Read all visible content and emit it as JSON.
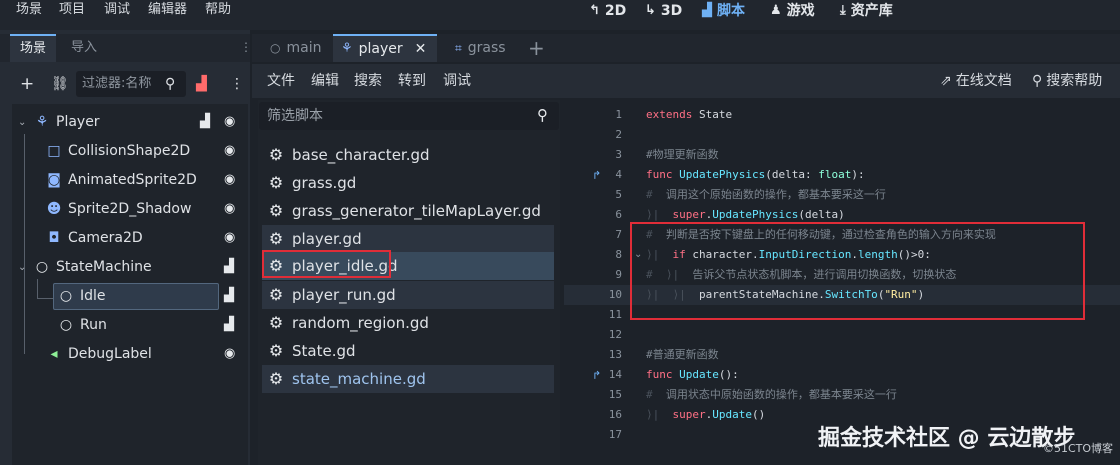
{
  "menubar": {
    "items": [
      "场景",
      "项目",
      "调试",
      "编辑器",
      "帮助"
    ]
  },
  "workspaces": [
    {
      "label": "2D",
      "icon": "2d-icon"
    },
    {
      "label": "3D",
      "icon": "3d-icon"
    },
    {
      "label": "脚本",
      "icon": "script-icon",
      "active": true
    },
    {
      "label": "游戏",
      "icon": "game-icon"
    },
    {
      "label": "资产库",
      "icon": "asset-lib-icon"
    }
  ],
  "dock": {
    "tabs": [
      "场景",
      "导入"
    ],
    "filter_placeholder": "过滤器:名称"
  },
  "tree": {
    "nodes": [
      {
        "label": "Player",
        "icon": "player-node-icon"
      },
      {
        "label": "CollisionShape2D",
        "icon": "collision-shape-icon"
      },
      {
        "label": "AnimatedSprite2D",
        "icon": "animated-sprite-icon"
      },
      {
        "label": "Sprite2D_Shadow",
        "icon": "sprite-icon"
      },
      {
        "label": "Camera2D",
        "icon": "camera-icon"
      },
      {
        "label": "StateMachine",
        "icon": "node-icon"
      },
      {
        "label": "Idle",
        "icon": "node-icon"
      },
      {
        "label": "Run",
        "icon": "node-icon"
      },
      {
        "label": "DebugLabel",
        "icon": "label-icon"
      }
    ]
  },
  "editor_tabs": [
    {
      "label": "main"
    },
    {
      "label": "player",
      "active": true
    },
    {
      "label": "grass"
    }
  ],
  "script_menu": {
    "items": [
      "文件",
      "编辑",
      "搜索",
      "转到",
      "调试"
    ],
    "online_docs": "在线文档",
    "search_help": "搜索帮助"
  },
  "script_filter_placeholder": "筛选脚本",
  "scripts": [
    "base_character.gd",
    "grass.gd",
    "grass_generator_tileMapLayer.gd",
    "player.gd",
    "player_idle.gd",
    "player_run.gd",
    "random_region.gd",
    "State.gd",
    "state_machine.gd"
  ],
  "code": {
    "line_numbers": [
      "1",
      "2",
      "3",
      "4",
      "5",
      "6",
      "7",
      "8",
      "9",
      "10",
      "11",
      "12",
      "13",
      "14",
      "15",
      "16",
      "17"
    ],
    "l1a": "extends",
    "l1b": " State",
    "l3": "#物理更新函数",
    "l4a": "func",
    "l4b": " UpdatePhysics",
    "l4c": "(delta: ",
    "l4d": "float",
    "l4e": "):",
    "l5": "调用这个原始函数的操作，都基本要采这一行",
    "l6a": "super",
    "l6b": ".",
    "l6c": "UpdatePhysics",
    "l6d": "(delta)",
    "l7": "判断是否按下键盘上的任何移动键，通过检查角色的输入方向来实现",
    "l8a": "if",
    "l8b": " character.",
    "l8c": "InputDirection",
    "l8d": ".",
    "l8e": "length",
    "l8f": "()>0:",
    "l9": "告诉父节点状态机脚本，进行调用切换函数，切换状态",
    "l10a": "parentStateMachine.",
    "l10b": "SwitchTo",
    "l10c": "(",
    "l10d": "\"Run\"",
    "l10e": ")",
    "l13": "#普通更新函数",
    "l14a": "func",
    "l14b": " Update",
    "l14c": "():",
    "l15": "调用状态中原始函数的操作，都基本要采这一行",
    "l16a": "super",
    "l16b": ".",
    "l16c": "Update",
    "l16d": "()"
  },
  "watermark": {
    "main": "掘金技术社区 @ 云边散步",
    "sub": "©51CTO博客"
  }
}
